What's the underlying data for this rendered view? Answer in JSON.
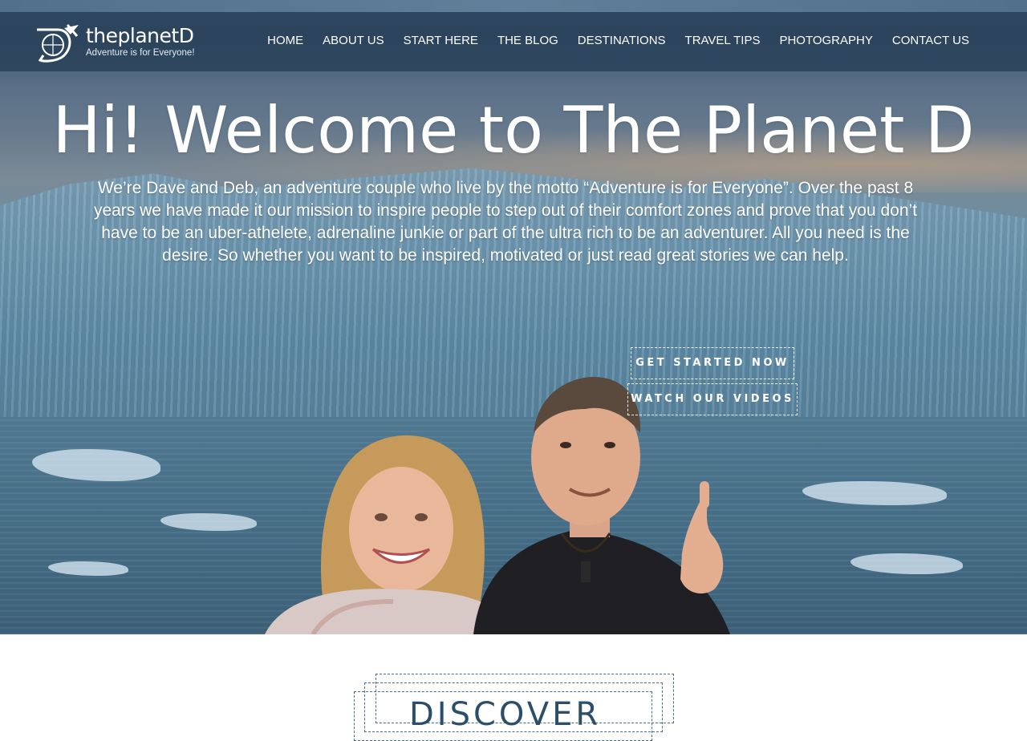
{
  "header": {
    "logo_name": "theplanetD",
    "logo_tagline": "Adventure is for Everyone!"
  },
  "nav": {
    "items": [
      {
        "label": "HOME"
      },
      {
        "label": "ABOUT US"
      },
      {
        "label": "START HERE"
      },
      {
        "label": "THE BLOG"
      },
      {
        "label": "DESTINATIONS"
      },
      {
        "label": "TRAVEL TIPS"
      },
      {
        "label": "PHOTOGRAPHY"
      },
      {
        "label": "CONTACT US"
      }
    ]
  },
  "hero": {
    "title": "Hi! Welcome to The Planet D",
    "text": "We’re Dave and Deb, an adventure couple who live by the motto “Adventure is for Everyone”. Over the past 8 years we have made it our mission to inspire people to step out of their comfort zones and prove that you don’t have to be an uber-athelete, adrenaline junkie or part of the ultra rich to be an adventurer. All you need is the desire. So whether you want to be inspired, motivated or just read great stories we can help.",
    "cta_primary": "GET STARTED NOW",
    "cta_secondary": "WATCH OUR VIDEOS"
  },
  "discover": {
    "label": "DISCOVER"
  },
  "colors": {
    "nav_bg": "#284058",
    "accent": "#4a6e8a",
    "hero_text": "#ffffff"
  }
}
